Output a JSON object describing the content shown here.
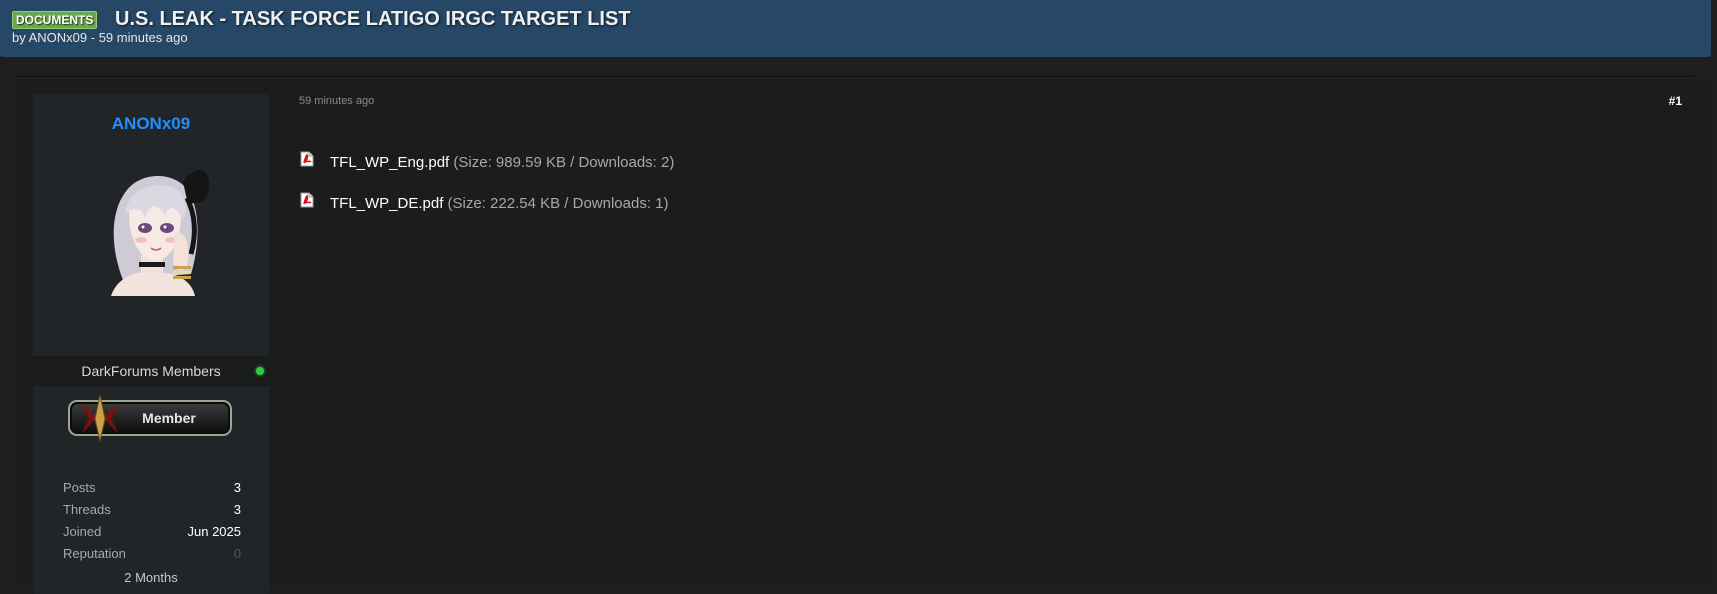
{
  "thread": {
    "badge": "DOCUMENTS",
    "title": "U.S. LEAK - TASK FORCE LATIGO IRGC TARGET LIST",
    "meta": "by ANONx09 - 59 minutes ago"
  },
  "post": {
    "time": "59 minutes ago",
    "number": "#1",
    "attachments": [
      {
        "name": "TFL_WP_Eng.pdf",
        "info": " (Size: 989.59 KB / Downloads: 2)",
        "icon": "pdf-icon"
      },
      {
        "name": "TFL_WP_DE.pdf",
        "info": " (Size: 222.54 KB / Downloads: 1)",
        "icon": "pdf-icon"
      }
    ]
  },
  "author": {
    "username": "ANONx09",
    "avatar": "anime-girl-avatar",
    "usergroup": "DarkForums Members",
    "online": true,
    "rank_badge": "Member",
    "stats": [
      {
        "label": "Posts",
        "value": "3"
      },
      {
        "label": "Threads",
        "value": "3"
      },
      {
        "label": "Joined",
        "value": "Jun 2025"
      },
      {
        "label": "Reputation",
        "value": "0"
      }
    ],
    "tenure": "2 Months"
  },
  "colors": {
    "header_bg": "#264765",
    "badge_bg": "#6aa84f",
    "username": "#1e90ff",
    "online": "#2ecc40",
    "page_bg": "#1e1e1e"
  }
}
